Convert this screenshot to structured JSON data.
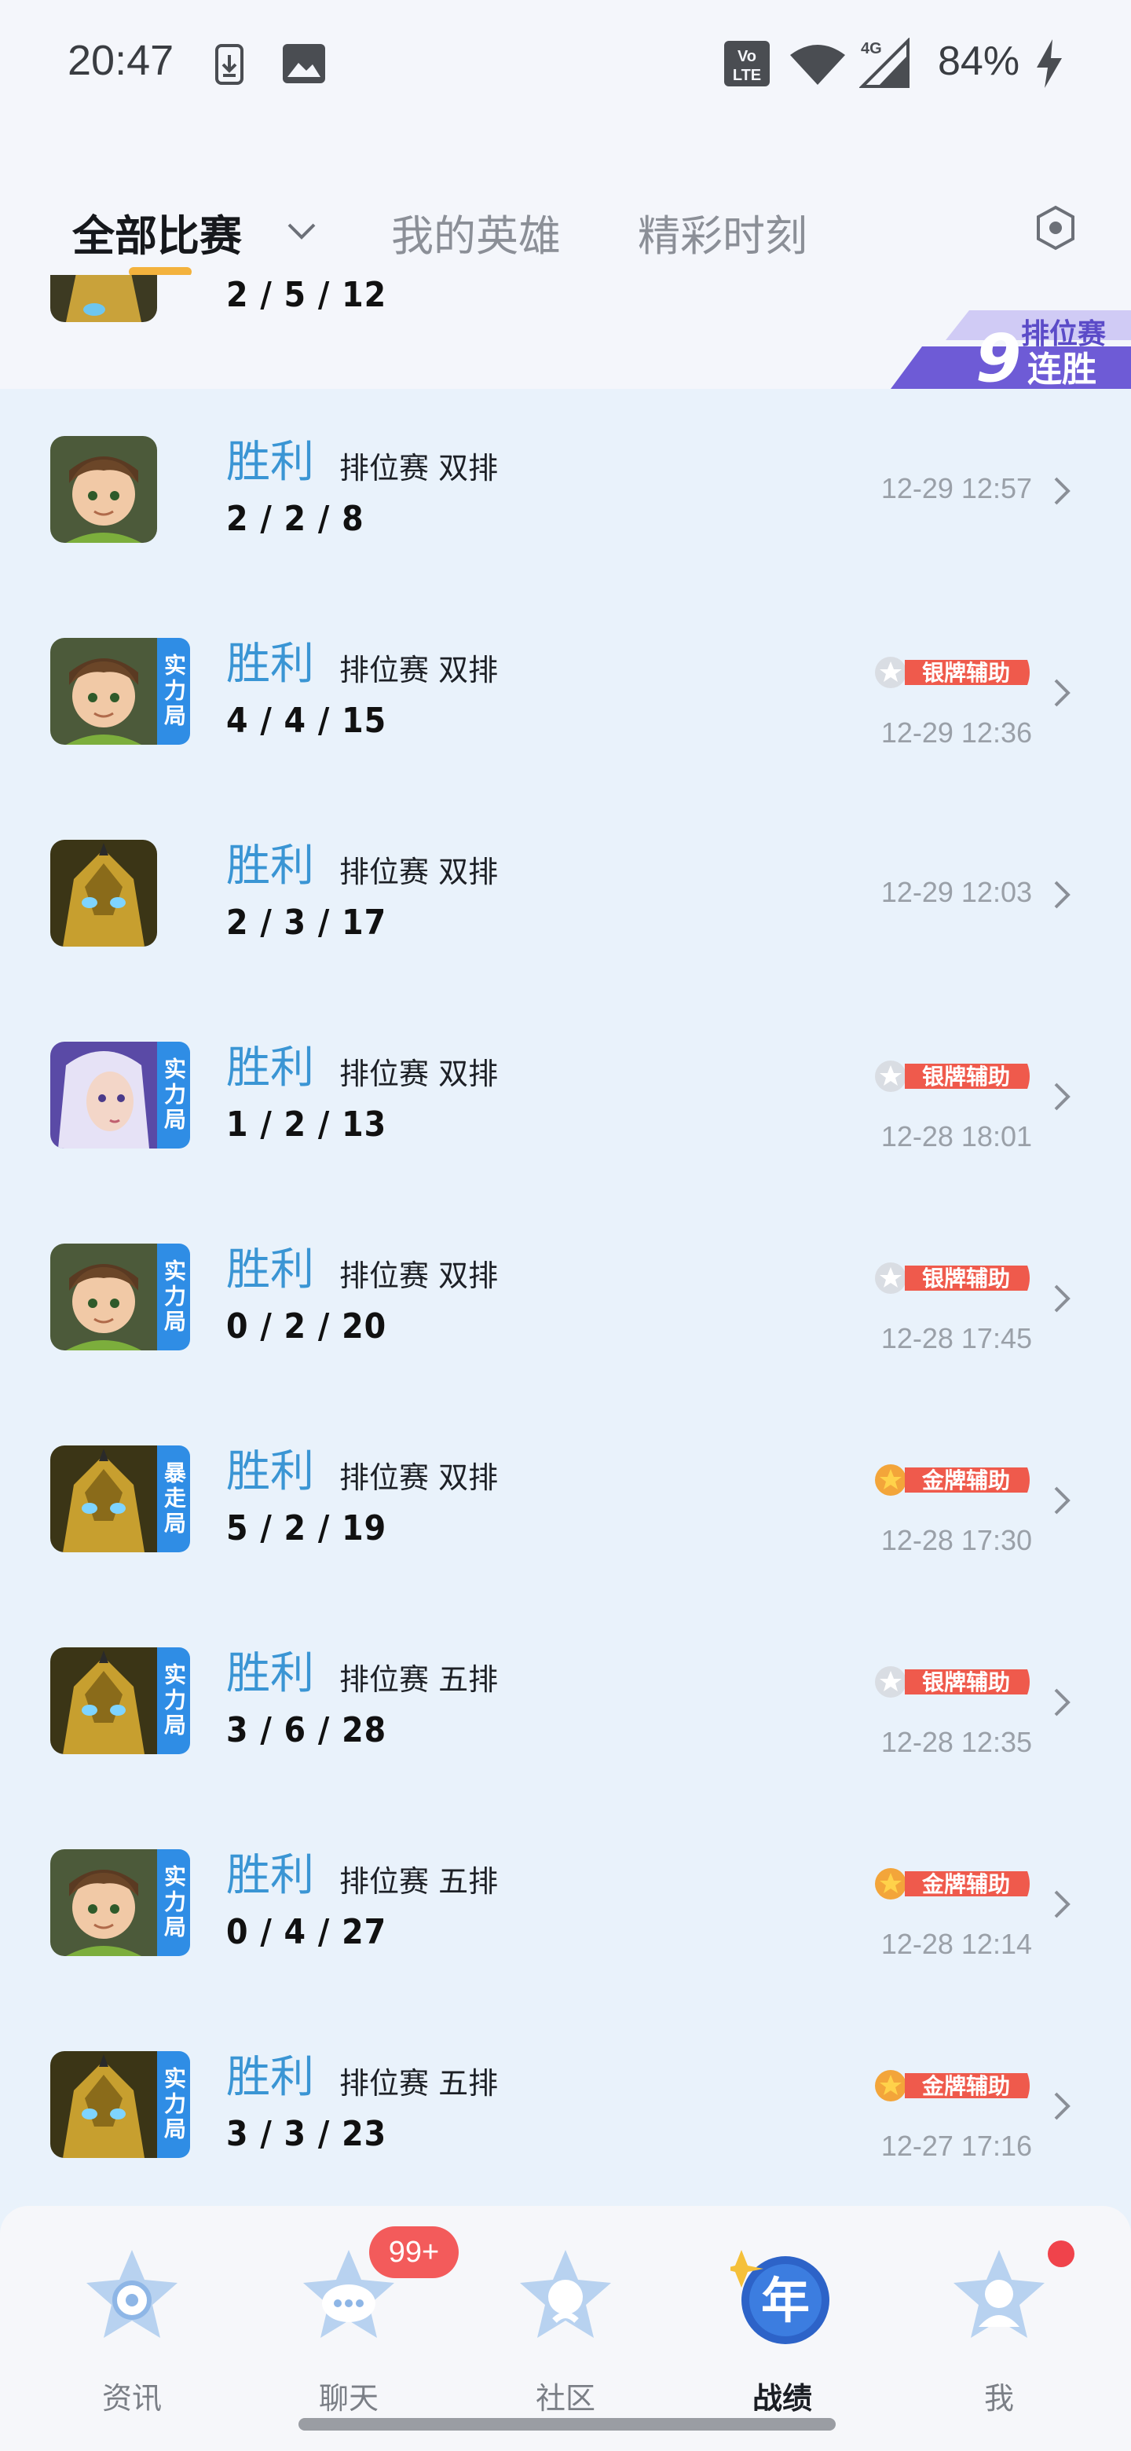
{
  "status_bar": {
    "time": "20:47",
    "battery": "84%",
    "icons": [
      "download-icon",
      "image-icon",
      "volte-icon",
      "wifi-icon",
      "signal-4g-icon",
      "charging-icon"
    ]
  },
  "top_tabs": {
    "items": [
      "全部比赛",
      "我的英雄",
      "精彩时刻"
    ],
    "active_index": 0
  },
  "partial_item": {
    "kda": "2 / 5 / 12",
    "streak_number": "9",
    "streak_top": "排位赛",
    "streak_bottom": "连胜"
  },
  "matches": [
    {
      "hero": "boy",
      "badge": "",
      "result": "胜利",
      "type": "排位赛 双排",
      "kda": "2 / 2 / 8",
      "medal": "",
      "time": "12-29 12:57"
    },
    {
      "hero": "boy",
      "badge": "实力局",
      "result": "胜利",
      "type": "排位赛 双排",
      "kda": "4 / 4 / 15",
      "medal": "银牌辅助",
      "medal_color": "silver",
      "time": "12-29 12:36"
    },
    {
      "hero": "gold",
      "badge": "",
      "result": "胜利",
      "type": "排位赛 双排",
      "kda": "2 / 3 / 17",
      "medal": "",
      "time": "12-29 12:03"
    },
    {
      "hero": "mage",
      "badge": "实力局",
      "result": "胜利",
      "type": "排位赛 双排",
      "kda": "1 / 2 / 13",
      "medal": "银牌辅助",
      "medal_color": "silver",
      "time": "12-28 18:01"
    },
    {
      "hero": "boy",
      "badge": "实力局",
      "result": "胜利",
      "type": "排位赛 双排",
      "kda": "0 / 2 / 20",
      "medal": "银牌辅助",
      "medal_color": "silver",
      "time": "12-28 17:45"
    },
    {
      "hero": "gold",
      "badge": "暴走局",
      "result": "胜利",
      "type": "排位赛 双排",
      "kda": "5 / 2 / 19",
      "medal": "金牌辅助",
      "medal_color": "gold",
      "time": "12-28 17:30"
    },
    {
      "hero": "gold",
      "badge": "实力局",
      "result": "胜利",
      "type": "排位赛 五排",
      "kda": "3 / 6 / 28",
      "medal": "银牌辅助",
      "medal_color": "silver",
      "time": "12-28 12:35"
    },
    {
      "hero": "boy",
      "badge": "实力局",
      "result": "胜利",
      "type": "排位赛 五排",
      "kda": "0 / 4 / 27",
      "medal": "金牌辅助",
      "medal_color": "gold",
      "time": "12-28 12:14"
    },
    {
      "hero": "gold",
      "badge": "实力局",
      "result": "胜利",
      "type": "排位赛 五排",
      "kda": "3 / 3 / 23",
      "medal": "金牌辅助",
      "medal_color": "gold",
      "time": "12-27 17:16"
    }
  ],
  "bottom_nav": {
    "items": [
      {
        "label": "资讯",
        "icon": "news-icon"
      },
      {
        "label": "聊天",
        "icon": "chat-icon",
        "badge": "99+"
      },
      {
        "label": "社区",
        "icon": "community-icon"
      },
      {
        "label": "战绩",
        "icon": "record-year-icon",
        "active": true,
        "icon_text": "年"
      },
      {
        "label": "我",
        "icon": "profile-icon",
        "dot": true
      }
    ]
  },
  "colors": {
    "accent_blue": "#3a95d4",
    "badge_blue": "#2f8de5",
    "tab_underline": "#f3b23d",
    "notification_red": "#f35b5b",
    "list_bg": "#e9f2fb"
  }
}
